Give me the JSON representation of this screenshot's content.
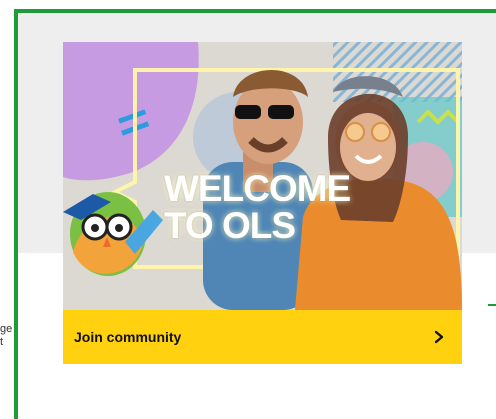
{
  "promo": {
    "headline_line1": "WELCOME",
    "headline_line2": "TO OLS"
  },
  "cta": {
    "label": "Join community",
    "icon": "chevron-right-icon"
  },
  "edge_text": {
    "line1": "ge",
    "line2": "t"
  },
  "colors": {
    "accent_green": "#1f9b3a",
    "cta_yellow": "#ffd10f"
  }
}
